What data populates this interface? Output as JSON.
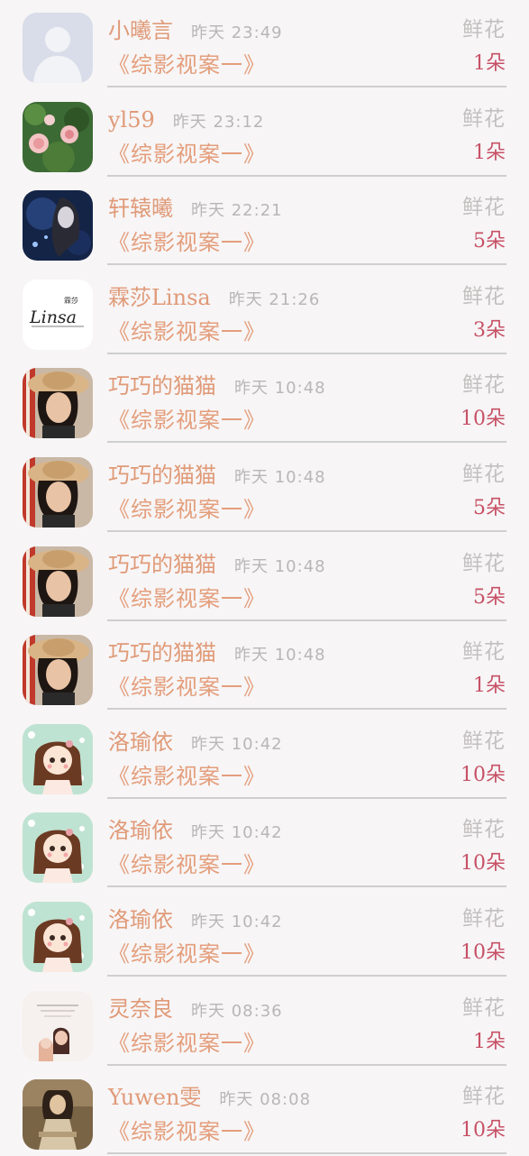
{
  "items": [
    {
      "name": "小曦言",
      "time": "昨天 23:49",
      "book": "《综影视案一》",
      "gift": "鲜花",
      "count": "1朵",
      "avatar_icon": "default-avatar-icon"
    },
    {
      "name": "yl59",
      "time": "昨天 23:12",
      "book": "《综影视案一》",
      "gift": "鲜花",
      "count": "1朵",
      "avatar_icon": "rose-avatar-icon"
    },
    {
      "name": "轩辕曦",
      "time": "昨天 22:21",
      "book": "《综影视案一》",
      "gift": "鲜花",
      "count": "5朵",
      "avatar_icon": "dark-fantasy-avatar-icon"
    },
    {
      "name": "霖莎Linsa",
      "time": "昨天 21:26",
      "book": "《综影视案一》",
      "gift": "鲜花",
      "count": "3朵",
      "avatar_icon": "linsa-logo-avatar-icon",
      "avatar_logo_text": "霖莎",
      "avatar_logo_script": "Linsa"
    },
    {
      "name": "巧巧的猫猫",
      "time": "昨天 10:48",
      "book": "《综影视案一》",
      "gift": "鲜花",
      "count": "10朵",
      "avatar_icon": "hat-woman-avatar-icon"
    },
    {
      "name": "巧巧的猫猫",
      "time": "昨天 10:48",
      "book": "《综影视案一》",
      "gift": "鲜花",
      "count": "5朵",
      "avatar_icon": "hat-woman-avatar-icon"
    },
    {
      "name": "巧巧的猫猫",
      "time": "昨天 10:48",
      "book": "《综影视案一》",
      "gift": "鲜花",
      "count": "5朵",
      "avatar_icon": "hat-woman-avatar-icon"
    },
    {
      "name": "巧巧的猫猫",
      "time": "昨天 10:48",
      "book": "《综影视案一》",
      "gift": "鲜花",
      "count": "1朵",
      "avatar_icon": "hat-woman-avatar-icon"
    },
    {
      "name": "洛瑜依",
      "time": "昨天 10:42",
      "book": "《综影视案一》",
      "gift": "鲜花",
      "count": "10朵",
      "avatar_icon": "cartoon-girl-avatar-icon"
    },
    {
      "name": "洛瑜依",
      "time": "昨天 10:42",
      "book": "《综影视案一》",
      "gift": "鲜花",
      "count": "10朵",
      "avatar_icon": "cartoon-girl-avatar-icon"
    },
    {
      "name": "洛瑜依",
      "time": "昨天 10:42",
      "book": "《综影视案一》",
      "gift": "鲜花",
      "count": "10朵",
      "avatar_icon": "cartoon-girl-avatar-icon"
    },
    {
      "name": "灵奈良",
      "time": "昨天 08:36",
      "book": "《综影视案一》",
      "gift": "鲜花",
      "count": "1朵",
      "avatar_icon": "couple-illustration-avatar-icon"
    },
    {
      "name": "Yuwen雯",
      "time": "昨天 08:08",
      "book": "《综影视案一》",
      "gift": "鲜花",
      "count": "10朵",
      "avatar_icon": "sepia-photo-avatar-icon"
    }
  ],
  "colors": {
    "name": "#e09a78",
    "book": "#e49e7c",
    "time": "#b9b6b6",
    "gift": "#c3c0c0",
    "count": "#c75166",
    "divider": "#cfcfcf",
    "background": "#f7f5f6"
  }
}
